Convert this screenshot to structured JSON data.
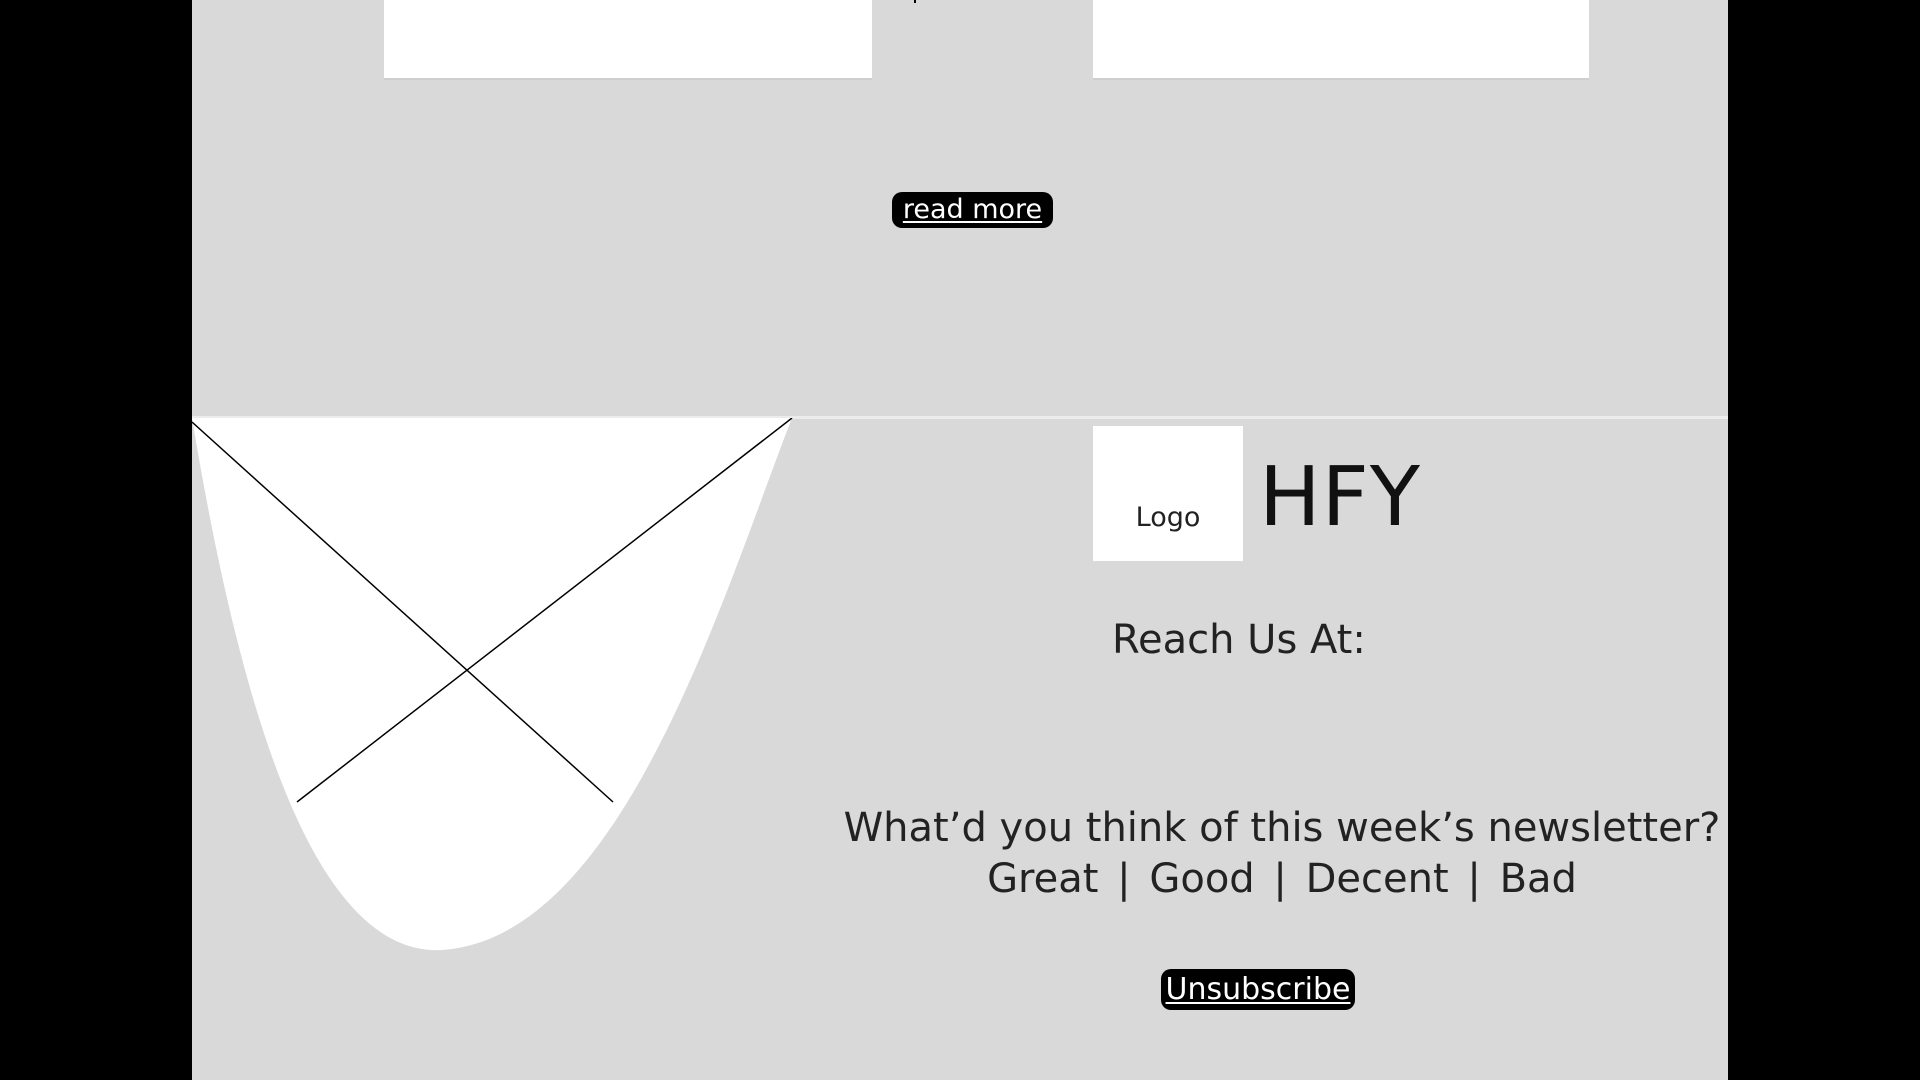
{
  "read_more": {
    "label": "read more"
  },
  "footer": {
    "logo_placeholder": "Logo",
    "brand": "HFY",
    "reach_us": "Reach Us At:",
    "feedback_question": "What’d you think of this week’s newsletter?",
    "feedback_options": [
      "Great",
      "Good",
      "Decent",
      "Bad"
    ],
    "feedback_separator": "|",
    "unsubscribe_label": "Unsubscribe"
  },
  "icons": {
    "image_placeholder": "image-placeholder-icon"
  },
  "colors": {
    "background": "#d9d9d9",
    "surface": "#ffffff",
    "page_outside": "#000000",
    "button_bg": "#000000",
    "button_text": "#ffffff"
  }
}
